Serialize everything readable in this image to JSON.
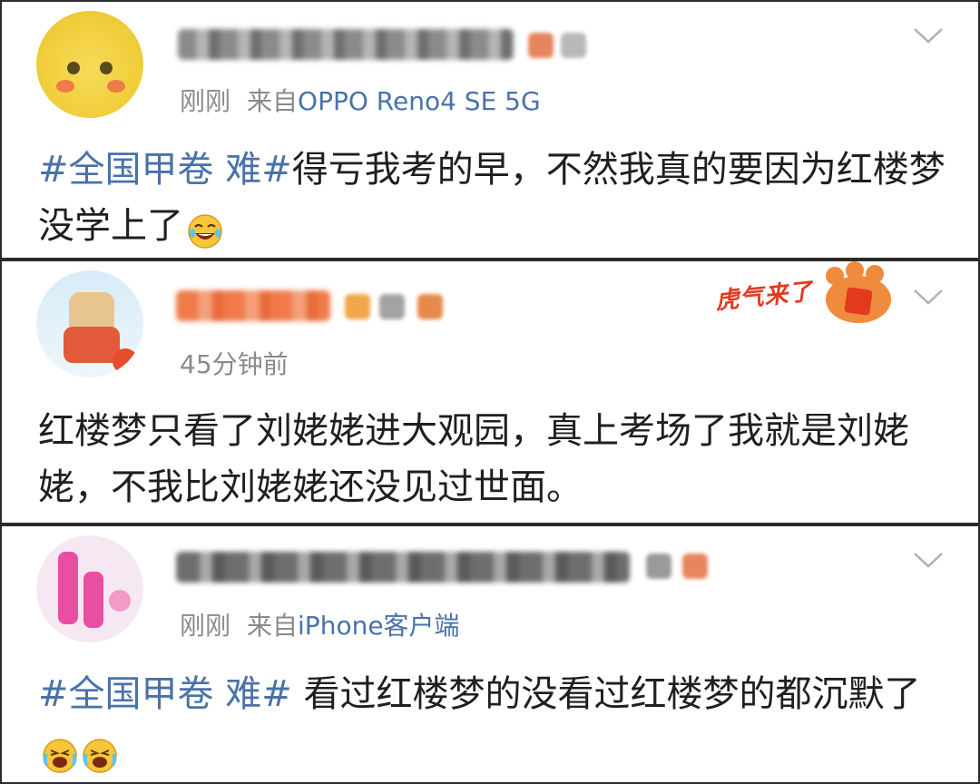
{
  "posts": [
    {
      "meta_time": "刚刚",
      "meta_from": "来自",
      "meta_source": "OPPO Reno4 SE 5G",
      "topic": "#全国甲卷 难#",
      "text": "得亏我考的早，不然我真的要因为红楼梦没学上了",
      "emoji": "laughing-tears-emoji",
      "menu_icon": "chevron-down-icon"
    },
    {
      "meta_time": "45分钟前",
      "text": "红楼梦只看了刘姥姥进大观园，真上考场了我就是刘姥姥，不我比刘姥姥还没见过世面。",
      "stamp_text": "虎气来了",
      "menu_icon": "chevron-down-icon"
    },
    {
      "meta_time": "刚刚",
      "meta_from": "来自",
      "meta_source": "iPhone客户端",
      "topic": "#全国甲卷 难#",
      "text": " 看过红楼梦的没看过红楼梦的都沉默了",
      "emoji": "crying-laughing-emoji",
      "menu_icon": "chevron-down-icon"
    }
  ],
  "colors": {
    "topic_link": "#4a72a8",
    "meta_gray": "#8a8a8a",
    "text": "#1f1f1f",
    "border": "#2b2b2b"
  }
}
